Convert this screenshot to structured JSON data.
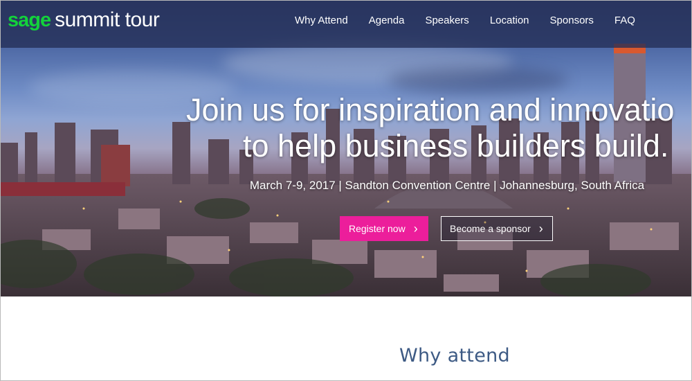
{
  "brand": {
    "name": "sage",
    "product": "summit tour",
    "brand_color": "#13d23b"
  },
  "nav": {
    "items": [
      "Why Attend",
      "Agenda",
      "Speakers",
      "Location",
      "Sponsors",
      "FAQ"
    ]
  },
  "hero": {
    "headline_line1": "Join us for inspiration and innovatio",
    "headline_line2": "to help business builders build.",
    "event_details": "March 7-9, 2017 | Sandton Convention Centre | Johannesburg, South Africa",
    "primary_cta": "Register now",
    "secondary_cta": "Become a sponsor",
    "accent_color": "#ec1e9b"
  },
  "section": {
    "title": "Why attend"
  }
}
